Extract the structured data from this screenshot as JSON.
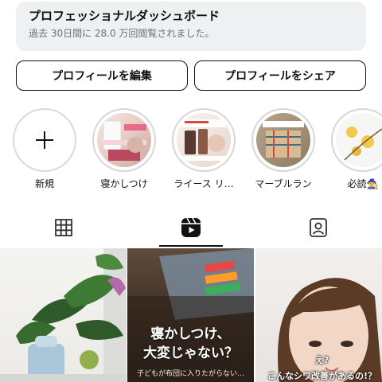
{
  "dashboard": {
    "title": "プロフェッショナルダッシュボード",
    "subtitle": "過去 30日間に 28.0 万回閲覧されました。"
  },
  "actions": {
    "edit_label": "プロフィールを編集",
    "share_label": "プロフィールをシェア"
  },
  "highlights": [
    {
      "label": "新規",
      "icon": "plus-icon"
    },
    {
      "label": "寝かしつけ"
    },
    {
      "label": "ライース リ…"
    },
    {
      "label": "マーブルラン"
    },
    {
      "label": "必読🧙‍♀️"
    }
  ],
  "tabs": [
    {
      "name": "grid",
      "icon": "grid-icon",
      "active": false
    },
    {
      "name": "reels",
      "icon": "reels-icon",
      "active": true
    },
    {
      "name": "tagged",
      "icon": "tagged-person-icon",
      "active": false
    }
  ],
  "posts": [
    {
      "type": "photo"
    },
    {
      "type": "reel",
      "title_line1": "寝かしつけ、",
      "title_line2": "大変じゃない？",
      "caption": "子どもが布団に入りたがらない…"
    },
    {
      "type": "reel",
      "overlay_top": "え?",
      "overlay_bottom": "こんなシワ改善があるの!？"
    }
  ]
}
